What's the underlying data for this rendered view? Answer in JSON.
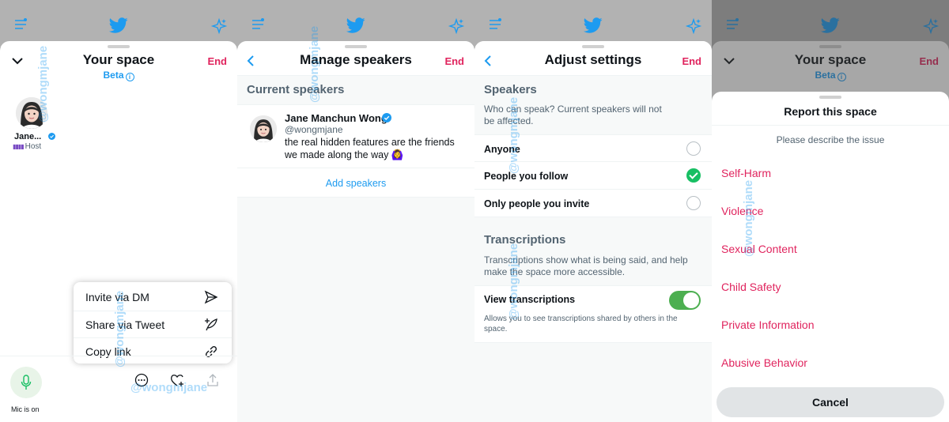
{
  "watermark": "@wongmjane",
  "panel1": {
    "title": "Your space",
    "end": "End",
    "beta": "Beta",
    "info_glyph": "i",
    "host_name": "Jane...",
    "host_role": "Host",
    "menu": [
      {
        "label": "Invite via DM",
        "icon": "send-icon"
      },
      {
        "label": "Share via Tweet",
        "icon": "compose-tweet-icon"
      },
      {
        "label": "Copy link",
        "icon": "link-icon"
      }
    ],
    "mic_label": "Mic is on"
  },
  "panel2": {
    "title": "Manage speakers",
    "end": "End",
    "section": "Current speakers",
    "speaker": {
      "name": "Jane Manchun Wong",
      "handle": "@wongmjane",
      "bio": "the real hidden features are the friends we made along the way 🙆‍♀️"
    },
    "add_speakers": "Add speakers"
  },
  "panel3": {
    "title": "Adjust settings",
    "end": "End",
    "speakers_section": "Speakers",
    "speakers_desc": "Who can speak? Current speakers will not be affected.",
    "options": [
      {
        "label": "Anyone",
        "selected": false
      },
      {
        "label": "People you follow",
        "selected": true
      },
      {
        "label": "Only people you invite",
        "selected": false
      }
    ],
    "transcriptions_section": "Transcriptions",
    "transcriptions_desc": "Transcriptions show what is being said, and help make the space more accessible.",
    "view_transcriptions": "View transcriptions",
    "view_transcriptions_on": true,
    "view_transcriptions_desc": "Allows you to see transcriptions shared by others in the space."
  },
  "panel4": {
    "title": "Your space",
    "end": "End",
    "beta": "Beta",
    "info_glyph": "i",
    "report_title": "Report this space",
    "report_sub": "Please describe the issue",
    "options": [
      "Self-Harm",
      "Violence",
      "Sexual Content",
      "Child Safety",
      "Private Information",
      "Abusive Behavior"
    ],
    "cancel": "Cancel"
  },
  "colors": {
    "accent": "#1d9bf0",
    "end_red": "#e0245e",
    "check_green": "#17bf63",
    "toggle_green": "#4caf50"
  }
}
